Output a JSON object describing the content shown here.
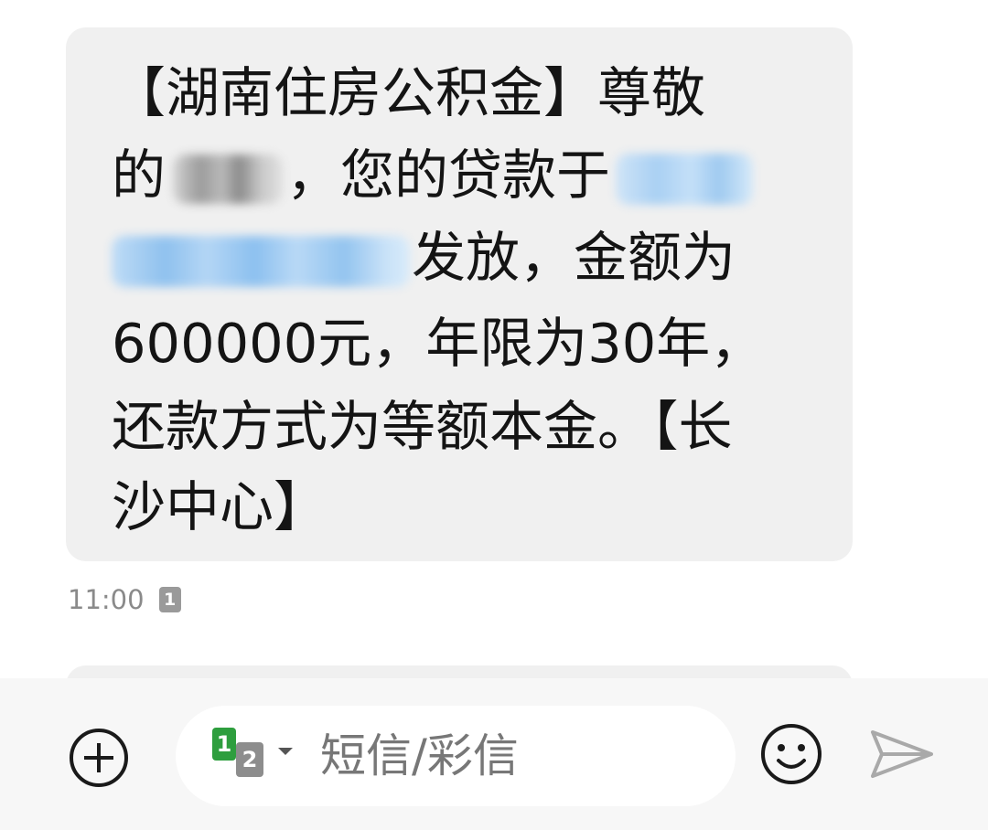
{
  "message": {
    "line1": "【湖南住房公积金】尊敬",
    "line2_prefix": "的",
    "line2_middle": "，您的贷款于",
    "line3_suffix": "发放，金额为",
    "line4": "600000元，年限为30年，",
    "line5": "还款方式为等额本金。【长",
    "line6": "沙中心】",
    "time": "11:00",
    "sim_badge": "1"
  },
  "composer": {
    "sim_primary": "1",
    "sim_secondary": "2",
    "placeholder": "短信/彩信"
  },
  "icons": {
    "add": "plus-circle-icon",
    "emoji": "smiley-icon",
    "send": "paper-plane-icon",
    "sim_dropdown": "caret-down-icon"
  },
  "colors": {
    "bubble_bg": "#f0f0f0",
    "text": "#141414",
    "time": "#8a8a8a",
    "sim_green": "#2e9e3e",
    "sim_gray": "#8d8d8d",
    "composer_bg": "#f7f7f7",
    "send_icon": "#a9a9a9"
  }
}
